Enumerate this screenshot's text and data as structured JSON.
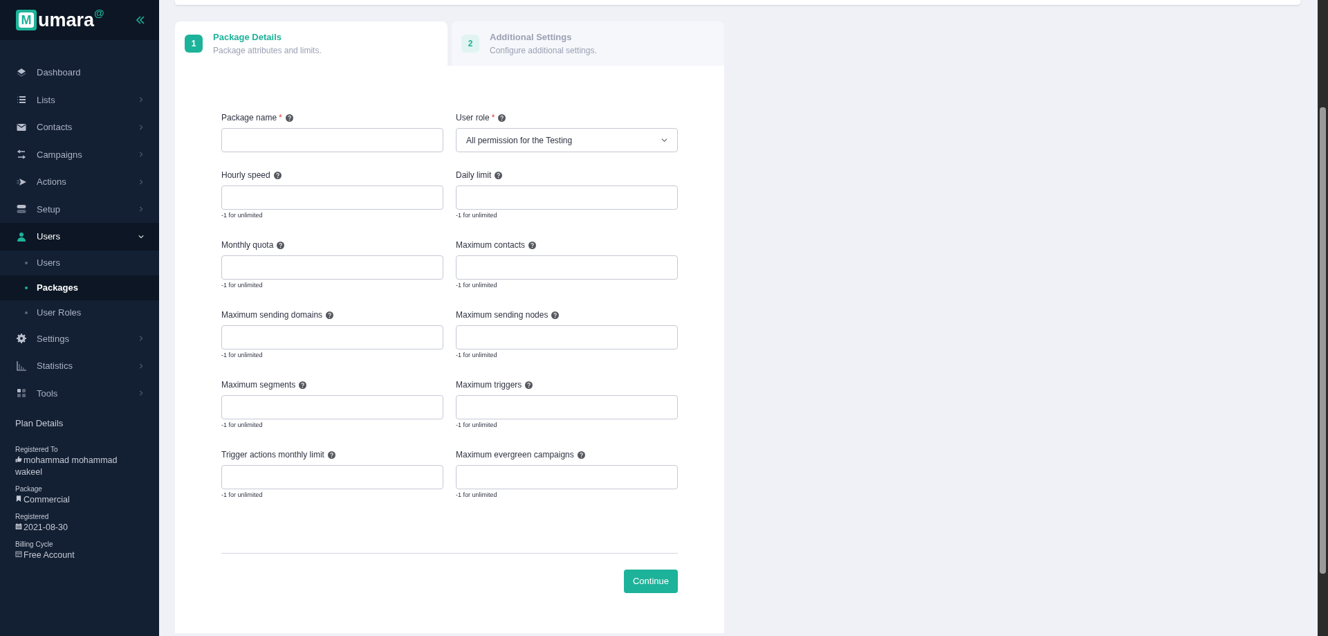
{
  "sidebar": {
    "logo": {
      "letter": "M",
      "text": "umara",
      "mark": "@"
    },
    "nav": [
      {
        "label": "Dashboard",
        "has_children": false,
        "expanded": false
      },
      {
        "label": "Lists",
        "has_children": true,
        "expanded": false
      },
      {
        "label": "Contacts",
        "has_children": true,
        "expanded": false
      },
      {
        "label": "Campaigns",
        "has_children": true,
        "expanded": false
      },
      {
        "label": "Actions",
        "has_children": true,
        "expanded": false
      },
      {
        "label": "Setup",
        "has_children": true,
        "expanded": false
      },
      {
        "label": "Users",
        "has_children": true,
        "expanded": true,
        "children": [
          {
            "label": "Users",
            "selected": false
          },
          {
            "label": "Packages",
            "selected": true
          },
          {
            "label": "User Roles",
            "selected": false
          }
        ]
      },
      {
        "label": "Settings",
        "has_children": true,
        "expanded": false
      },
      {
        "label": "Statistics",
        "has_children": true,
        "expanded": false
      },
      {
        "label": "Tools",
        "has_children": true,
        "expanded": false
      }
    ],
    "plan": {
      "title": "Plan Details",
      "items": [
        {
          "label": "Registered To",
          "value": "mohammad mohammad wakeel"
        },
        {
          "label": "Package",
          "value": "Commercial"
        },
        {
          "label": "Registered",
          "value": "2021-08-30"
        },
        {
          "label": "Billing Cycle",
          "value": "Free Account"
        }
      ]
    }
  },
  "steps": [
    {
      "number": "1",
      "title": "Package Details",
      "subtitle": "Package attributes and limits.",
      "selected": true
    },
    {
      "number": "2",
      "title": "Additional Settings",
      "subtitle": "Configure additional settings.",
      "selected": false
    }
  ],
  "form": {
    "fields": [
      {
        "label": "Package name",
        "required_mark": "*",
        "kind": "input"
      },
      {
        "label": "User role",
        "required_mark": "*",
        "kind": "select",
        "value": "All permission for the Testing"
      },
      {
        "label": "Hourly speed",
        "kind": "input",
        "hint": "-1 for unlimited"
      },
      {
        "label": "Daily limit",
        "kind": "input",
        "hint": "-1 for unlimited"
      },
      {
        "label": "Monthly quota",
        "kind": "input",
        "hint": "-1 for unlimited"
      },
      {
        "label": "Maximum contacts",
        "kind": "input",
        "hint": "-1 for unlimited"
      },
      {
        "label": "Maximum sending domains",
        "kind": "input",
        "hint": "-1 for unlimited"
      },
      {
        "label": "Maximum sending nodes",
        "kind": "input",
        "hint": "-1 for unlimited"
      },
      {
        "label": "Maximum segments",
        "kind": "input",
        "hint": "-1 for unlimited"
      },
      {
        "label": "Maximum triggers",
        "kind": "input",
        "hint": "-1 for unlimited"
      },
      {
        "label": "Trigger actions monthly limit",
        "kind": "input",
        "hint": "-1 for unlimited"
      },
      {
        "label": "Maximum evergreen campaigns",
        "kind": "input",
        "hint": "-1 for unlimited"
      }
    ],
    "button": "Continue"
  }
}
